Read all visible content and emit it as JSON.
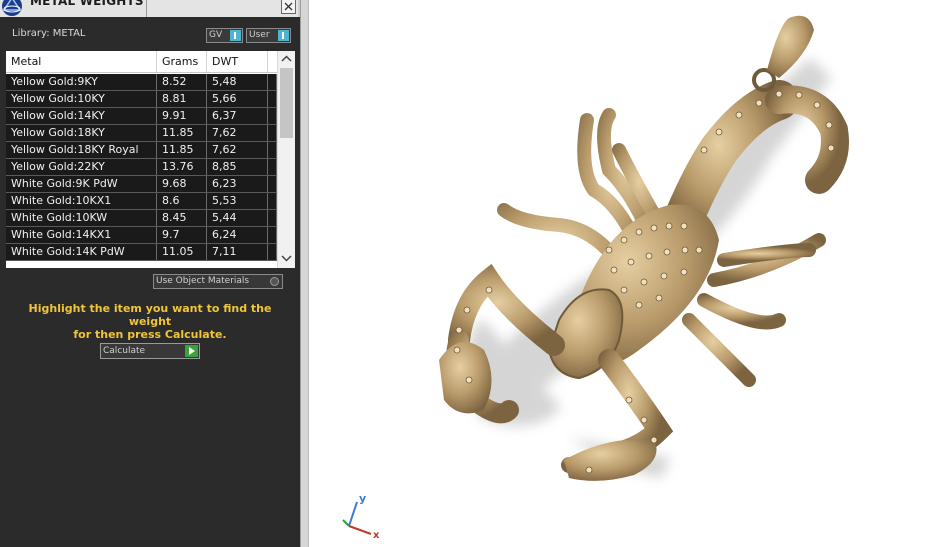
{
  "window": {
    "title": "METAL WEIGHTS"
  },
  "library": {
    "label": "Library: METAL"
  },
  "toggles": {
    "gv_label": "GV",
    "user_label": "User"
  },
  "table": {
    "headers": {
      "metal": "Metal",
      "grams": "Grams",
      "dwt": "DWT"
    },
    "rows": [
      {
        "metal": "Yellow Gold:9KY",
        "grams": "8.52",
        "dwt": "5,48"
      },
      {
        "metal": "Yellow Gold:10KY",
        "grams": "8.81",
        "dwt": "5,66"
      },
      {
        "metal": "Yellow Gold:14KY",
        "grams": "9.91",
        "dwt": "6,37"
      },
      {
        "metal": "Yellow Gold:18KY",
        "grams": "11.85",
        "dwt": "7,62"
      },
      {
        "metal": "Yellow Gold:18KY Royal",
        "grams": "11.85",
        "dwt": "7,62"
      },
      {
        "metal": "Yellow Gold:22KY",
        "grams": "13.76",
        "dwt": "8,85"
      },
      {
        "metal": "White Gold:9K PdW",
        "grams": "9.68",
        "dwt": "6,23"
      },
      {
        "metal": "White Gold:10KX1",
        "grams": "8.6",
        "dwt": "5,53"
      },
      {
        "metal": "White Gold:10KW",
        "grams": "8.45",
        "dwt": "5,44"
      },
      {
        "metal": "White Gold:14KX1",
        "grams": "9.7",
        "dwt": "6,24"
      },
      {
        "metal": "White Gold:14K PdW",
        "grams": "11.05",
        "dwt": "7,11"
      }
    ],
    "scroll_fraction": 0.0
  },
  "use_object_materials": {
    "label": "Use Object Materials",
    "checked": false
  },
  "hint": {
    "line1": "Highlight the item you want to find the weight",
    "line2": "for then press Calculate."
  },
  "calculate": {
    "label": "Calculate"
  },
  "viewport": {
    "axis_y": "y",
    "axis_x": "x"
  },
  "colors": {
    "panel": "#2b2b2b",
    "hint": "#f0c53a",
    "metal": "#b59a6a",
    "accent": "#4fb3d2"
  },
  "icons": {
    "logo": "app-logo-icon",
    "close": "close-icon",
    "go": "play-icon"
  }
}
